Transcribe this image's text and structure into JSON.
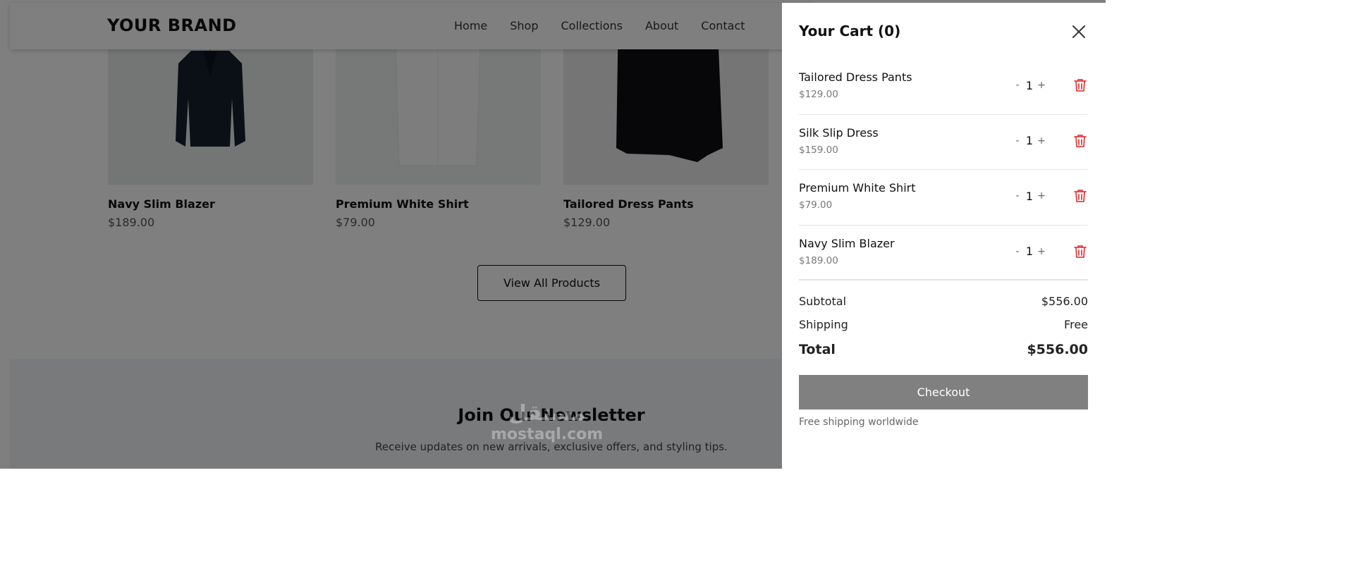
{
  "header": {
    "brand": "YOUR BRAND",
    "nav": [
      "Home",
      "Shop",
      "Collections",
      "About",
      "Contact"
    ]
  },
  "products": [
    {
      "name": "Navy Slim Blazer",
      "price": "$189.00"
    },
    {
      "name": "Premium White Shirt",
      "price": "$79.00"
    },
    {
      "name": "Tailored Dress Pants",
      "price": "$129.00"
    }
  ],
  "view_all_label": "View All Products",
  "newsletter": {
    "title": "Join Our Newsletter",
    "text": "Receive updates on new arrivals, exclusive offers, and styling tips."
  },
  "watermark": {
    "arabic": "مستقل",
    "latin": "mostaql.com"
  },
  "cart": {
    "title": "Your Cart (0)",
    "items": [
      {
        "name": "Tailored Dress Pants",
        "price": "$129.00",
        "qty": "1"
      },
      {
        "name": "Silk Slip Dress",
        "price": "$159.00",
        "qty": "1"
      },
      {
        "name": "Premium White Shirt",
        "price": "$79.00",
        "qty": "1"
      },
      {
        "name": "Navy Slim Blazer",
        "price": "$189.00",
        "qty": "1"
      }
    ],
    "qty_minus": "-",
    "qty_plus": "+",
    "subtotal_label": "Subtotal",
    "subtotal_value": "$556.00",
    "shipping_label": "Shipping",
    "shipping_value": "Free",
    "total_label": "Total",
    "total_value": "$556.00",
    "checkout_label": "Checkout",
    "note": "Free shipping worldwide",
    "colors": {
      "delete": "#e53e3e",
      "checkout_bg": "#808080"
    }
  }
}
